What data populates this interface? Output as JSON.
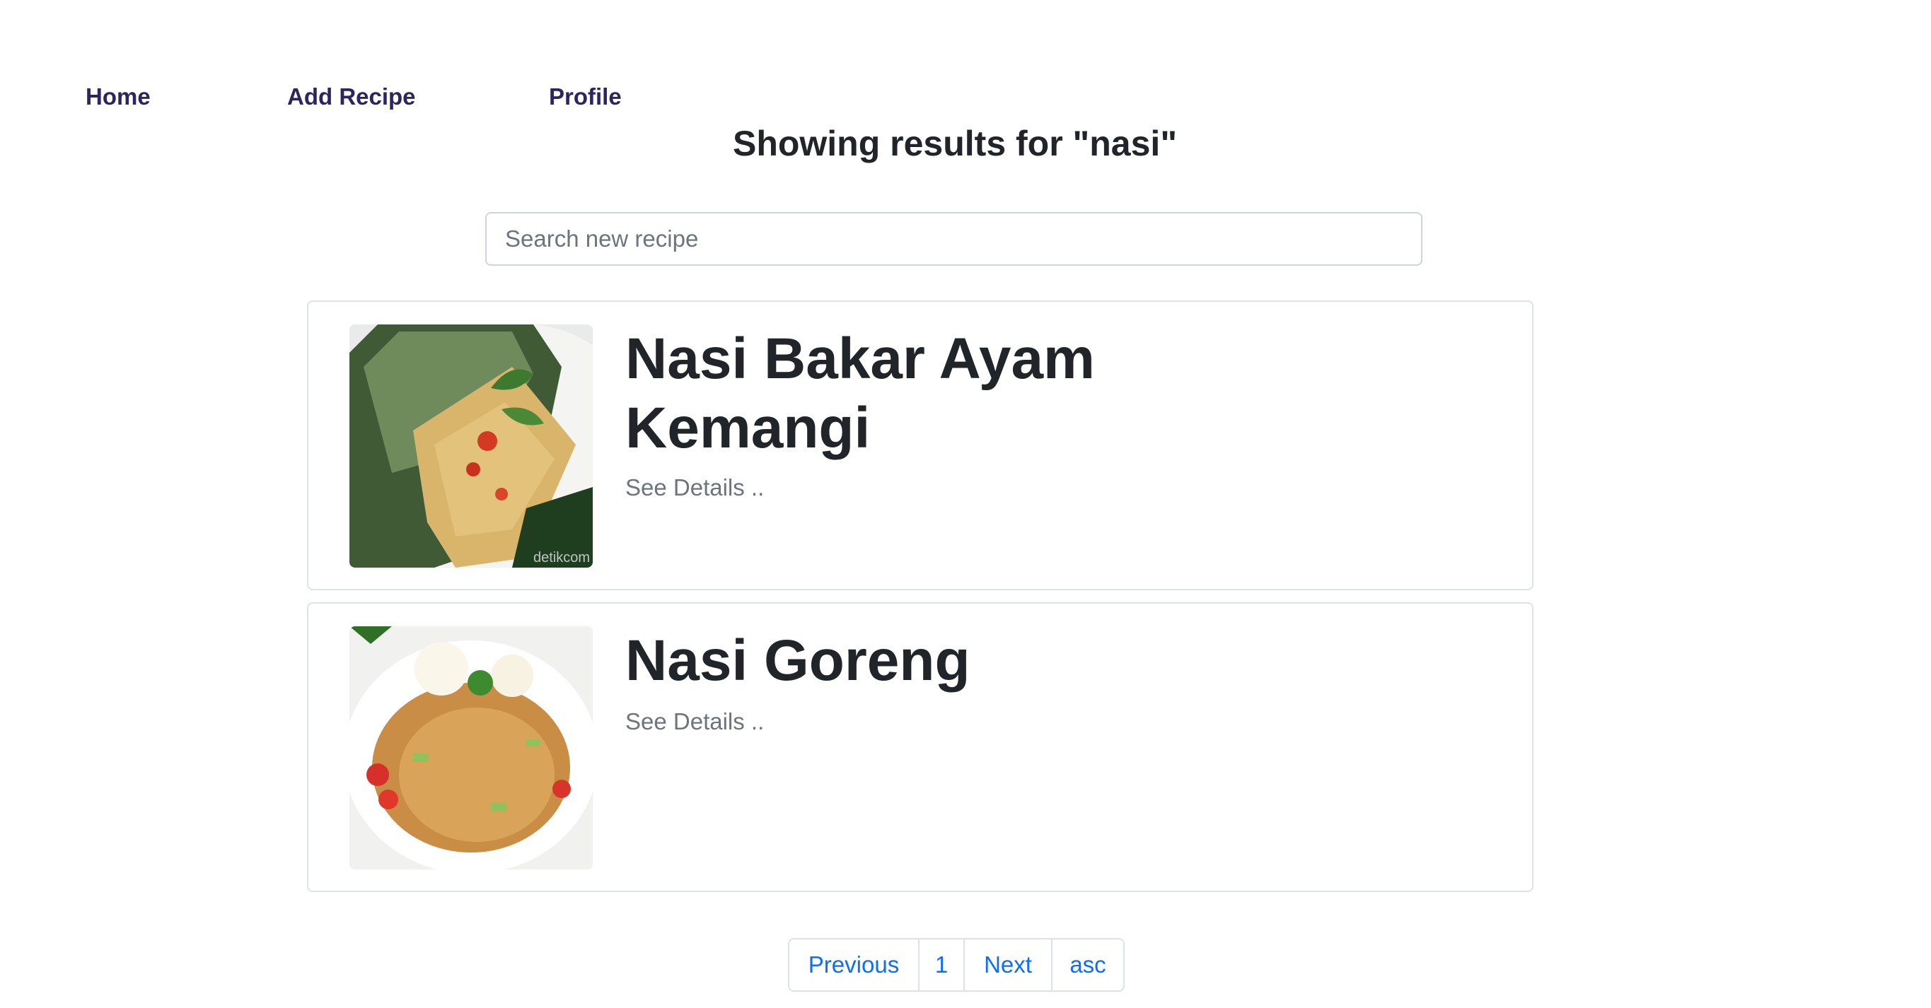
{
  "nav": {
    "home": "Home",
    "add_recipe": "Add Recipe",
    "profile": "Profile"
  },
  "heading": "Showing results for \"nasi\"",
  "search": {
    "placeholder": "Search new recipe",
    "value": ""
  },
  "recipes": [
    {
      "title": "Nasi Bakar Ayam Kemangi",
      "details_label": "See Details ..",
      "image_watermark": "detikcom"
    },
    {
      "title": "Nasi Goreng",
      "details_label": "See Details .."
    }
  ],
  "pagination": {
    "previous": "Previous",
    "page": "1",
    "next": "Next",
    "sort": "asc"
  },
  "colors": {
    "nav_text": "#2b2560",
    "link": "#0d6efd",
    "muted": "#6c757d",
    "border": "#dfe2e6"
  }
}
